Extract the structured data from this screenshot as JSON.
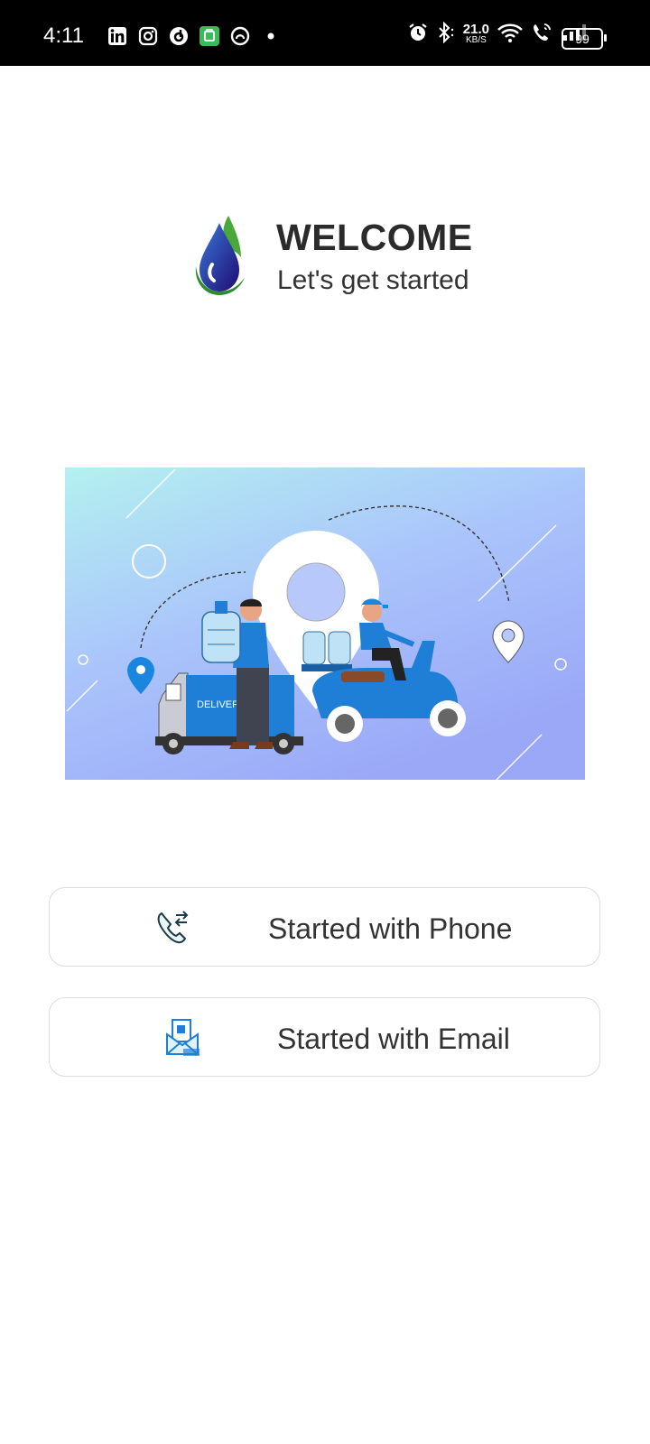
{
  "status_bar": {
    "time": "4:11",
    "speed_value": "21.0",
    "speed_unit": "KB/S",
    "battery": "99",
    "left_icons": [
      "linkedin-icon",
      "instagram-icon",
      "app-icon",
      "shop-icon",
      "app-icon-2",
      "dot-icon"
    ],
    "right_icons": [
      "alarm-icon",
      "bluetooth-icon",
      "wifi-icon",
      "call-icon",
      "signal-icon",
      "battery-icon"
    ]
  },
  "header": {
    "title": "WELCOME",
    "subtitle": "Let's get started"
  },
  "hero": {
    "truck_text": "DELIVERY"
  },
  "buttons": {
    "phone_label": "Started with Phone",
    "email_label": "Started with Email"
  },
  "colors": {
    "accent_blue": "#1f7fd6",
    "hero_top": "#b4f1ef",
    "hero_bottom": "#9aa8f7",
    "drop_dark": "#2a1a8e",
    "leaf_green": "#3ea33a"
  }
}
